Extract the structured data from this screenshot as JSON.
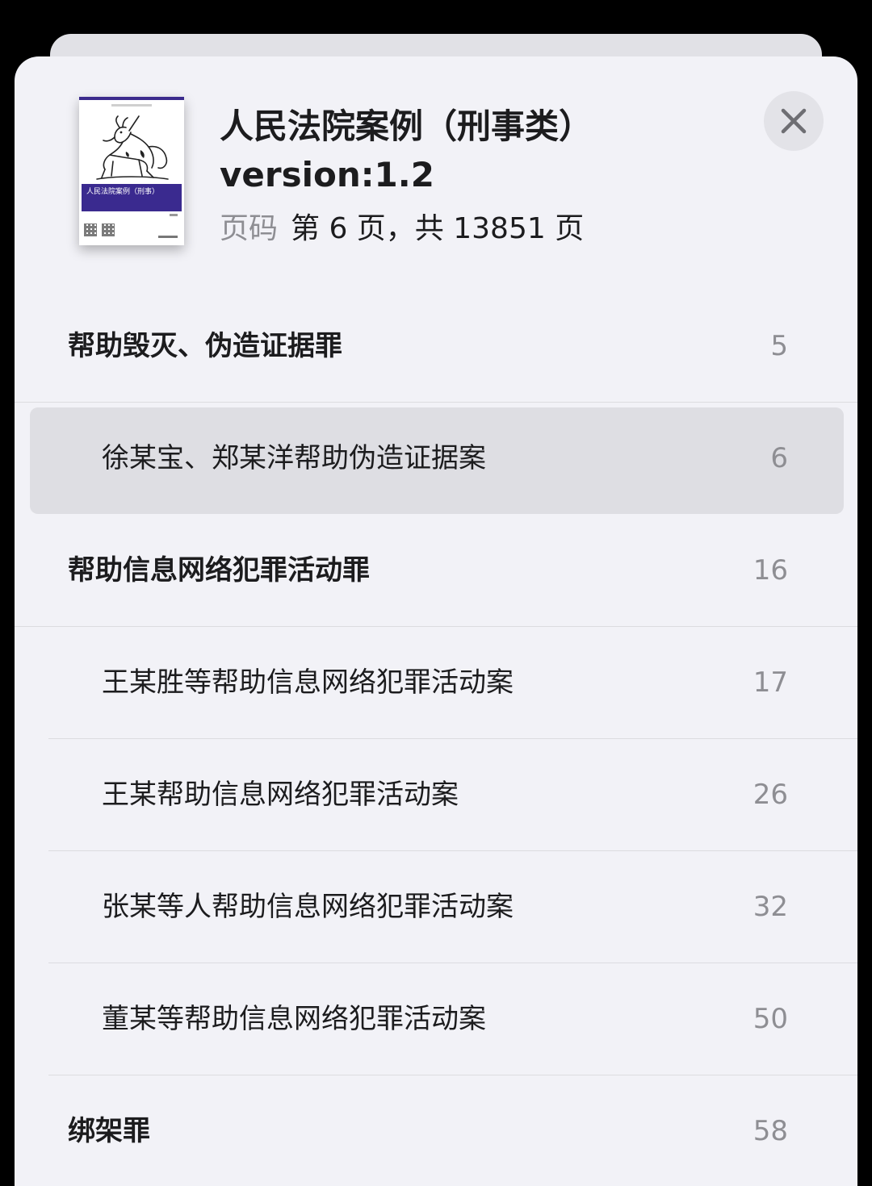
{
  "book": {
    "title": "人民法院案例（刑事类）",
    "version": "version:1.2",
    "page_label": "页码",
    "page_value": "第 6 页，共 13851 页",
    "cover_text": "人民法院案例（刑事）"
  },
  "close_icon": "close-icon",
  "colors": {
    "sheet_bg": "#f2f2f7",
    "highlight": "#dedee3",
    "cover_band": "#3a2a8f",
    "secondary_text": "#8e8e93"
  },
  "toc": [
    {
      "type": "chapter",
      "title": "帮助毁灭、伪造证据罪",
      "page": "5"
    },
    {
      "type": "section",
      "title": "徐某宝、郑某洋帮助伪造证据案",
      "page": "6",
      "selected": true
    },
    {
      "type": "chapter",
      "title": "帮助信息网络犯罪活动罪",
      "page": "16"
    },
    {
      "type": "section",
      "title": "王某胜等帮助信息网络犯罪活动案",
      "page": "17"
    },
    {
      "type": "section",
      "title": "王某帮助信息网络犯罪活动案",
      "page": "26"
    },
    {
      "type": "section",
      "title": "张某等人帮助信息网络犯罪活动案",
      "page": "32"
    },
    {
      "type": "section",
      "title": "董某等帮助信息网络犯罪活动案",
      "page": "50"
    },
    {
      "type": "chapter",
      "title": "绑架罪",
      "page": "58"
    }
  ]
}
